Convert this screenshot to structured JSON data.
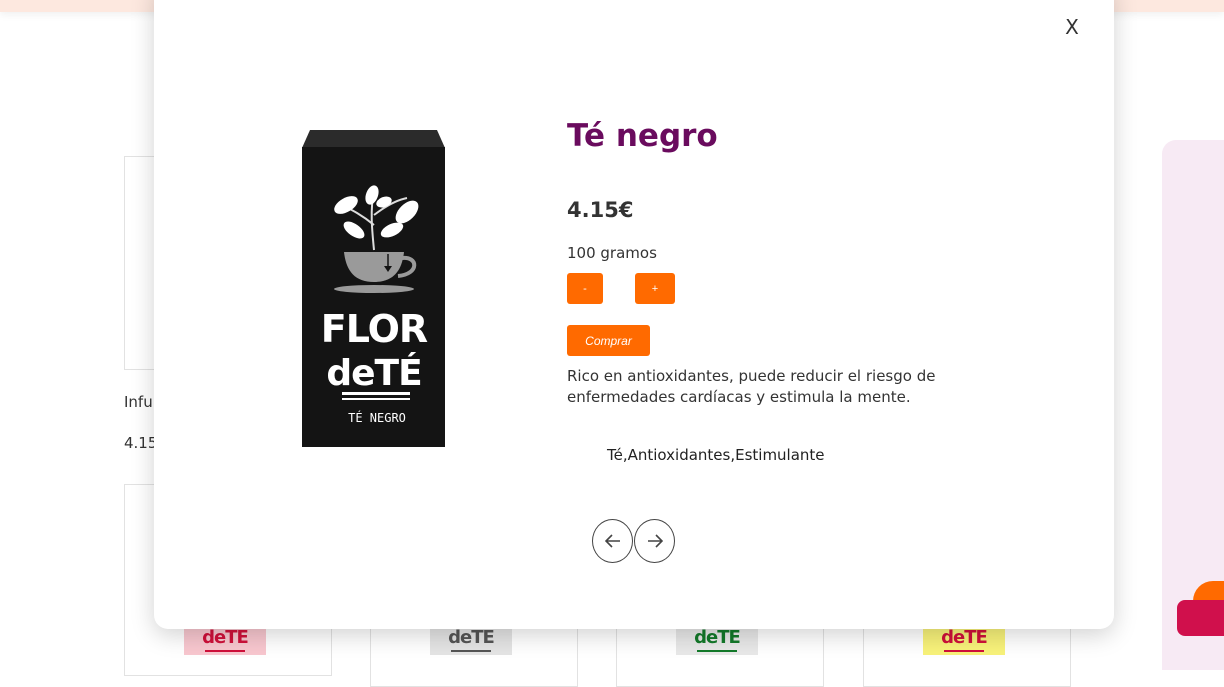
{
  "background": {
    "card_text": "Infu",
    "card_price": "4.15",
    "thumbnails": [
      {
        "label": "deTE",
        "color": "#d0103a",
        "bg": "#f8c7cf"
      },
      {
        "label": "deTE",
        "color": "#555555",
        "bg": "#e4e4e4"
      },
      {
        "label": "deTE",
        "color": "#137a2a",
        "bg": "#e8e8e8"
      },
      {
        "label": "deTE",
        "color": "#d0103a",
        "bg": "#f8f27a"
      }
    ]
  },
  "modal": {
    "close_label": "X",
    "title": "Té negro",
    "price": "4.15€",
    "weight": "100 gramos",
    "minus_label": "-",
    "plus_label": "+",
    "buy_label": "Comprar",
    "description": "Rico en antioxidantes, puede reducir el riesgo de enfermedades cardíacas y estimula la mente.",
    "tags": "Té,Antioxidantes,Estimulante",
    "image": {
      "brand_line1": "FLOR",
      "brand_line2": "deTÉ",
      "product_label": "TÉ NEGRO",
      "icon": "tea-cup-plant-icon"
    },
    "prev_icon": "arrow-left-icon",
    "next_icon": "arrow-right-icon"
  }
}
